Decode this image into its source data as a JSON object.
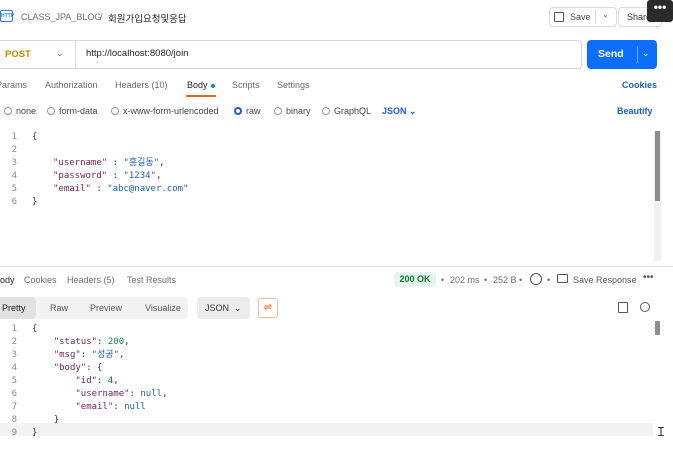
{
  "header": {
    "logo_text": "HTTP",
    "collection": "CLASS_JPA_BLOG",
    "separator": "/",
    "request_name": "회원가입요청및응답",
    "save_label": "Save",
    "share_label": "Share",
    "more_label": "•••"
  },
  "request": {
    "method": "POST",
    "url": "http://localhost:8080/join",
    "send_label": "Send",
    "tabs": [
      "Params",
      "Authorization",
      "Headers (10)",
      "Body",
      "Scripts",
      "Settings"
    ],
    "active_tab": "Body",
    "cookies_label": "Cookies",
    "body_types": [
      "none",
      "form-data",
      "x-www-form-urlencoded",
      "raw",
      "binary",
      "GraphQL"
    ],
    "selected_body_type": "raw",
    "format_label": "JSON",
    "beautify_label": "Beautify",
    "lines": [
      {
        "n": "1",
        "text": "{"
      },
      {
        "n": "2",
        "text": ""
      },
      {
        "n": "3",
        "key": "\"username\"",
        "sep": " : ",
        "val": "\"홍길동\"",
        "end": ","
      },
      {
        "n": "4",
        "key": "\"password\"",
        "sep": " : ",
        "val": "\"1234\"",
        "end": ","
      },
      {
        "n": "5",
        "key": "\"email\"",
        "sep": " : ",
        "val": "\"abc@naver.com\"",
        "end": ""
      },
      {
        "n": "6",
        "text": "}"
      }
    ]
  },
  "response": {
    "tabs": [
      "Body",
      "Cookies",
      "Headers (5)",
      "Test Results"
    ],
    "status": "200 OK",
    "time": "202 ms",
    "size": "252 B",
    "save_response_label": "Save Response",
    "more_label": "•••",
    "view_tabs": [
      "Pretty",
      "Raw",
      "Preview",
      "Visualize"
    ],
    "active_view": "Pretty",
    "format_label": "JSON",
    "lines": [
      {
        "n": "1",
        "text": "{"
      },
      {
        "n": "2",
        "indent": "    ",
        "key": "\"status\"",
        "sep": ": ",
        "val": "200",
        "type": "num",
        "end": ","
      },
      {
        "n": "3",
        "indent": "    ",
        "key": "\"msg\"",
        "sep": ": ",
        "val": "\"성공\"",
        "type": "str",
        "end": ","
      },
      {
        "n": "4",
        "indent": "    ",
        "key": "\"body\"",
        "sep": ": ",
        "val": "{",
        "type": "p",
        "end": ""
      },
      {
        "n": "5",
        "indent": "        ",
        "key": "\"id\"",
        "sep": ": ",
        "val": "4",
        "type": "num",
        "end": ","
      },
      {
        "n": "6",
        "indent": "        ",
        "key": "\"username\"",
        "sep": ": ",
        "val": "null",
        "type": "null",
        "end": ","
      },
      {
        "n": "7",
        "indent": "        ",
        "key": "\"email\"",
        "sep": ": ",
        "val": "null",
        "type": "null",
        "end": ""
      },
      {
        "n": "8",
        "indent": "    ",
        "text": "}"
      },
      {
        "n": "9",
        "text": "}"
      }
    ]
  },
  "colors": {
    "send": "#0d6efd",
    "method": "#b88a00",
    "active_tab_underline": "#e0671f",
    "status_ok": "#0b7a3b",
    "link": "#1a5fd0"
  }
}
